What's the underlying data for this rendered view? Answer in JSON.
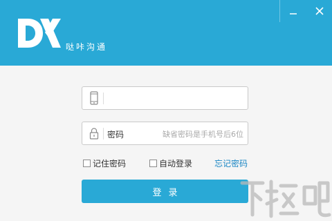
{
  "app": {
    "name": "哒咔沟通",
    "logo_text": "DX"
  },
  "window_controls": {
    "minimize_icon": "minimize-icon",
    "close_icon": "close-icon"
  },
  "form": {
    "phone": {
      "icon": "mobile-phone-icon",
      "value": "",
      "placeholder": ""
    },
    "password": {
      "icon": "lock-icon",
      "label": "密码",
      "hint": "缺省密码是手机号后6位"
    },
    "remember_password": {
      "label": "记住密码",
      "checked": false
    },
    "auto_login": {
      "label": "自动登录",
      "checked": false
    },
    "forgot_password_link": "忘记密码",
    "login_button": "登录"
  },
  "watermark": {
    "text": "下载吧"
  },
  "colors": {
    "brand": "#29a9d6",
    "link": "#1a86c4",
    "background": "#f5f5f5"
  }
}
